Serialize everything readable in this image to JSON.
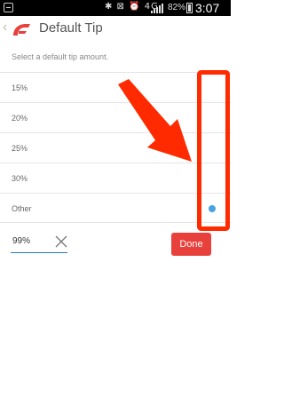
{
  "status_bar": {
    "battery_percent": "82%",
    "time": "3:07 PM",
    "network": "4G",
    "icons": [
      "notification-icon",
      "bluetooth-icon",
      "vibrate-icon",
      "alarm-icon",
      "4g-icon",
      "signal-icon",
      "battery-icon"
    ]
  },
  "header": {
    "title": "Default Tip"
  },
  "instructions": "Select a default tip amount.",
  "options": [
    {
      "label": "15%",
      "selected": false
    },
    {
      "label": "20%",
      "selected": false
    },
    {
      "label": "25%",
      "selected": false
    },
    {
      "label": "30%",
      "selected": false
    },
    {
      "label": "Other",
      "selected": true
    }
  ],
  "custom_tip": {
    "value": "99%"
  },
  "done_label": "Done",
  "colors": {
    "accent_red": "#e8403b",
    "selected_dot": "#4aa3df",
    "annotation_red": "#ff2a00",
    "input_underline": "#2a7bc0"
  }
}
